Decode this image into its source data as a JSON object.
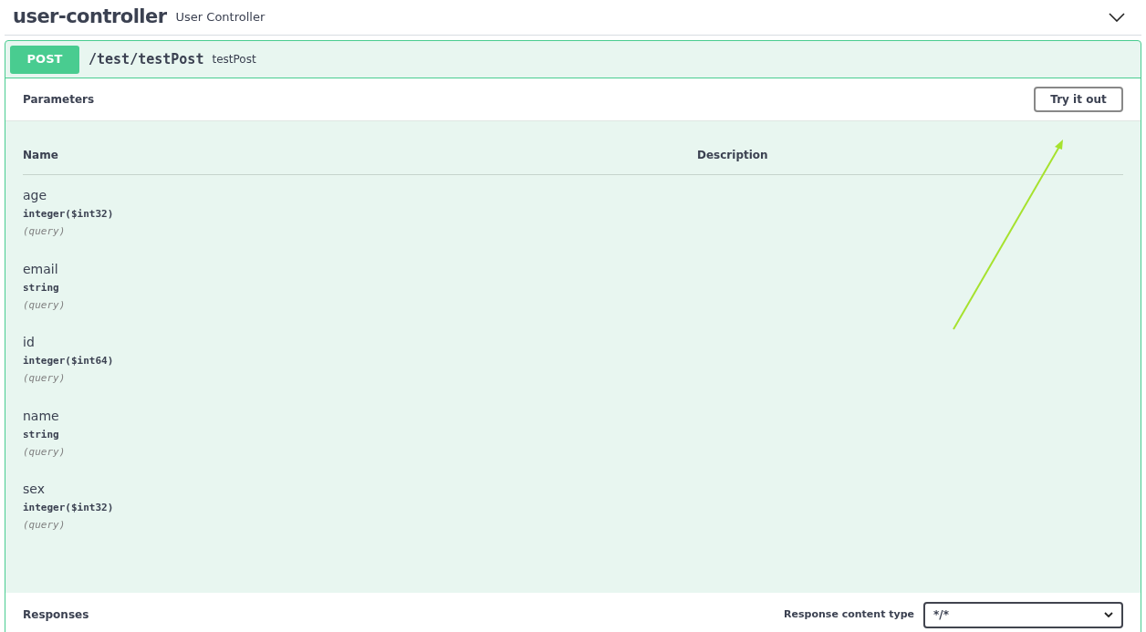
{
  "tag": {
    "name": "user-controller",
    "description": "User Controller",
    "expanded": true
  },
  "operation": {
    "method": "POST",
    "path": "/test/testPost",
    "summary": "testPost"
  },
  "parameters": {
    "title": "Parameters",
    "try_button": "Try it out",
    "columns": [
      "Name",
      "Description"
    ],
    "rows": [
      {
        "name": "age",
        "type": "integer($int32)",
        "location": "(query)"
      },
      {
        "name": "email",
        "type": "string",
        "location": "(query)"
      },
      {
        "name": "id",
        "type": "integer($int64)",
        "location": "(query)"
      },
      {
        "name": "name",
        "type": "string",
        "location": "(query)"
      },
      {
        "name": "sex",
        "type": "integer($int32)",
        "location": "(query)"
      }
    ]
  },
  "responses": {
    "title": "Responses",
    "content_type_label": "Response content type",
    "content_type_value": "*/*"
  }
}
